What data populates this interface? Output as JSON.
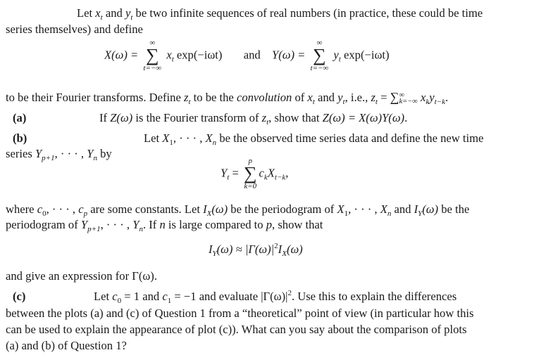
{
  "paragraph1": {
    "line1": "Let x_t and y_t be two infinite sequences of real numbers (in practice, these could be time",
    "l1_a": "Let ",
    "l1_x": "x",
    "l1_b": " and ",
    "l1_y": "y",
    "l1_c": " be two infinite sequences of real numbers (in practice, these could be time",
    "line2": "series themselves) and define"
  },
  "equation1": {
    "lhs_x": "X(ω) =",
    "sum_top": "∞",
    "sum_sym": "∑",
    "sum_bot": "t=−∞",
    "term_x_var": "x",
    "term_x_rest": " exp(−iωt)",
    "and": "and",
    "lhs_y": "Y(ω) =",
    "term_y_var": "y",
    "term_y_rest": " exp(−iωt)",
    "sub_t": "t"
  },
  "paragraph2": {
    "a": "to be their Fourier transforms. Define ",
    "z": "z",
    "sub_t": "t",
    "b": " to be the ",
    "conv": "convolution",
    "c": " of ",
    "x": "x",
    "d": " and ",
    "y": "y",
    "e": ", i.e., ",
    "z2": "z",
    "f": " = ",
    "sum": "∑",
    "sum_top": "∞",
    "sum_bot": "k=−∞",
    "xk": "x",
    "sub_k": "k",
    "yk": "y",
    "sub_tk": "t−k",
    "end": "."
  },
  "part_a": {
    "label": "(a)",
    "text1": "If ",
    "Z": "Z(ω)",
    "text2": " is the Fourier transform of ",
    "z": "z",
    "sub_t": "t",
    "text3": ", show that ",
    "eq": "Z(ω) = X(ω)Y(ω)",
    "end": "."
  },
  "part_b": {
    "label": "(b)",
    "text1": "Let ",
    "X1": "X",
    "sub1": "1",
    "dots": ", · · · , ",
    "Xn": "X",
    "subn": "n",
    "text2": " be the observed time series data and define the new time",
    "line2_a": "series ",
    "Y": "Y",
    "sub_p1": "p+1",
    "Yn": "Y",
    "line2_b": " by"
  },
  "equation2": {
    "lhs": "Y",
    "sub_t": "t",
    "eq": " =",
    "sum_top": "p",
    "sum_sym": "∑",
    "sum_bot": "k=0",
    "c": "c",
    "sub_k": "k",
    "X": "X",
    "sub_tk": "t−k",
    "end": ","
  },
  "paragraph3": {
    "l1_a": "where ",
    "c": "c",
    "sub0": "0",
    "dots": ", · · · , ",
    "subp": "p",
    "l1_b": " are some constants. Let ",
    "I": "I",
    "subX": "X",
    "omega": "(ω)",
    "l1_c": " be the periodogram of ",
    "X": "X",
    "sub1": "1",
    "subn": "n",
    "l1_d": " and ",
    "subY": "Y",
    "l1_e": " be the",
    "l2_a": "periodogram of ",
    "Y": "Y",
    "sub_p1": "p+1",
    "l2_b": ". If ",
    "n": "n",
    "l2_c": " is large compared to ",
    "p": "p",
    "l2_d": ", show that"
  },
  "equation3": {
    "I": "I",
    "subY": "Y",
    "approx": "(ω) ≈ |Γ(ω)|",
    "sup2": "2",
    "subX": "X",
    "omega": "(ω)"
  },
  "paragraph4": {
    "text": "and give an expression for Γ(ω)."
  },
  "part_c": {
    "label": "(c)",
    "t1": "Let ",
    "c": "c",
    "sub0": "0",
    "t2": " = 1 and ",
    "sub1": "1",
    "t3": " = −1 and evaluate |Γ(ω)|",
    "sup2": "2",
    "t4": ".  Use this to explain the differences",
    "line2": "between the plots (a) and (c) of Question 1 from a “theoretical” point of view (in particular how this",
    "line3": "can be used to explain the appearance of plot (c)).  What can you say about the comparison of plots",
    "line4": "(a) and (b) of Question 1?"
  }
}
